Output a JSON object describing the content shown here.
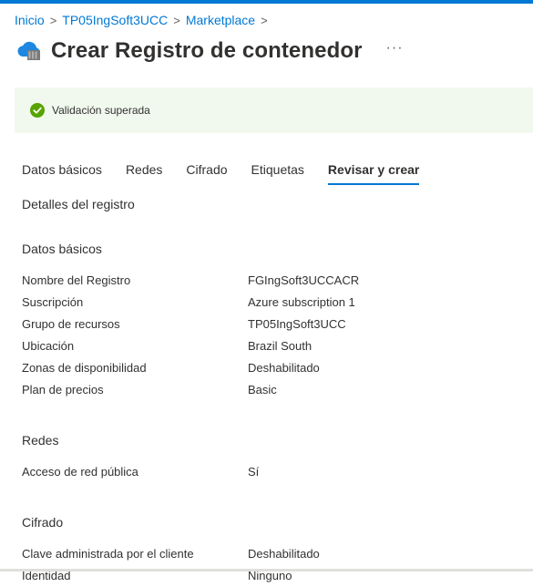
{
  "breadcrumb": {
    "items": [
      "Inicio",
      "TP05IngSoft3UCC",
      "Marketplace"
    ],
    "separator": ">"
  },
  "header": {
    "title": "Crear Registro de contenedor",
    "more": "···",
    "icon": "container-registry-icon"
  },
  "banner": {
    "icon": "check-circle-icon",
    "message": "Validación superada",
    "color": "#57a300"
  },
  "tabs": [
    {
      "label": "Datos básicos",
      "active": false
    },
    {
      "label": "Redes",
      "active": false
    },
    {
      "label": "Cifrado",
      "active": false
    },
    {
      "label": "Etiquetas",
      "active": false
    },
    {
      "label": "Revisar y crear",
      "active": true
    }
  ],
  "details": {
    "heading": "Detalles del registro",
    "basics": {
      "heading": "Datos básicos",
      "rows": [
        {
          "label": "Nombre del Registro",
          "value": "FGIngSoft3UCCACR"
        },
        {
          "label": "Suscripción",
          "value": "Azure subscription 1"
        },
        {
          "label": "Grupo de recursos",
          "value": "TP05IngSoft3UCC"
        },
        {
          "label": "Ubicación",
          "value": "Brazil South"
        },
        {
          "label": "Zonas de disponibilidad",
          "value": "Deshabilitado"
        },
        {
          "label": "Plan de precios",
          "value": "Basic"
        }
      ]
    },
    "networking": {
      "heading": "Redes",
      "rows": [
        {
          "label": "Acceso de red pública",
          "value": "Sí"
        }
      ]
    },
    "encryption": {
      "heading": "Cifrado",
      "rows": [
        {
          "label": "Clave administrada por el cliente",
          "value": "Deshabilitado"
        },
        {
          "label": "Identidad",
          "value": "Ninguno"
        }
      ]
    }
  },
  "colors": {
    "accent": "#0078d4",
    "banner_bg": "#f1f9ee"
  }
}
